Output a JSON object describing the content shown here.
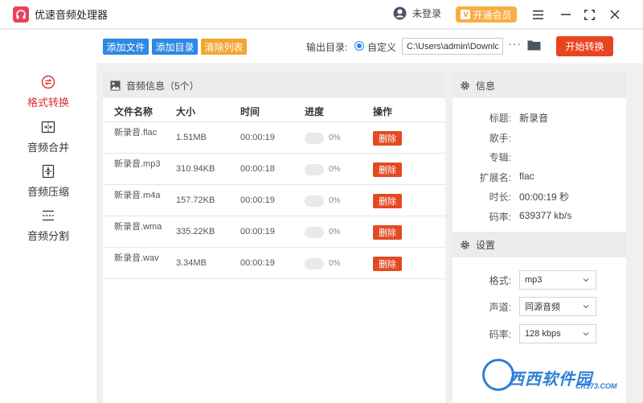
{
  "app": {
    "title": "优速音频处理器",
    "user_label": "未登录",
    "vip_badge": "V",
    "vip_label": "开通会员"
  },
  "sidebar": {
    "items": [
      {
        "label": "格式转换",
        "active": true
      },
      {
        "label": "音频合并",
        "active": false
      },
      {
        "label": "音频压缩",
        "active": false
      },
      {
        "label": "音频分割",
        "active": false
      }
    ]
  },
  "toolbar": {
    "add_file": "添加文件",
    "add_dir": "添加目录",
    "clear_list": "清除列表",
    "output_label": "输出目录:",
    "radio_label": "自定义",
    "output_path": "C:\\Users\\admin\\Downlc",
    "more": "···",
    "start": "开始转换"
  },
  "file_panel": {
    "title": "音频信息（5个）",
    "columns": [
      "文件名称",
      "大小",
      "时间",
      "进度",
      "操作"
    ],
    "rows": [
      {
        "name": "新录音.flac",
        "size": "1.51MB",
        "time": "00:00:19",
        "progress": 0,
        "pct": "0%",
        "action": "删除"
      },
      {
        "name": "新录音.mp3",
        "size": "310.94KB",
        "time": "00:00:18",
        "progress": 0,
        "pct": "0%",
        "action": "删除"
      },
      {
        "name": "新录音.m4a",
        "size": "157.72KB",
        "time": "00:00:19",
        "progress": 0,
        "pct": "0%",
        "action": "删除"
      },
      {
        "name": "新录音.wma",
        "size": "335.22KB",
        "time": "00:00:19",
        "progress": 0,
        "pct": "0%",
        "action": "删除"
      },
      {
        "name": "新录音.wav",
        "size": "3.34MB",
        "time": "00:00:19",
        "progress": 0,
        "pct": "0%",
        "action": "删除"
      }
    ]
  },
  "info_panel": {
    "title": "信息",
    "fields": [
      {
        "key": "标题:",
        "value": "新录音"
      },
      {
        "key": "歌手:",
        "value": ""
      },
      {
        "key": "专辑:",
        "value": ""
      },
      {
        "key": "扩展名:",
        "value": "flac"
      },
      {
        "key": "时长:",
        "value": "00:00:19 秒"
      },
      {
        "key": "码率:",
        "value": "639377 kb/s"
      }
    ]
  },
  "settings_panel": {
    "title": "设置",
    "fields": [
      {
        "key": "格式:",
        "value": "mp3"
      },
      {
        "key": "声道:",
        "value": "同源音频"
      },
      {
        "key": "码率:",
        "value": "128 kbps"
      }
    ]
  },
  "watermark": {
    "text": "西西软件园",
    "sub": "CR173.COM"
  },
  "colors": {
    "accent_red": "#d9302c",
    "button_blue": "#2e88e4",
    "button_orange": "#f3a533",
    "start_red": "#e94420",
    "vip_orange": "#f8ae45"
  }
}
